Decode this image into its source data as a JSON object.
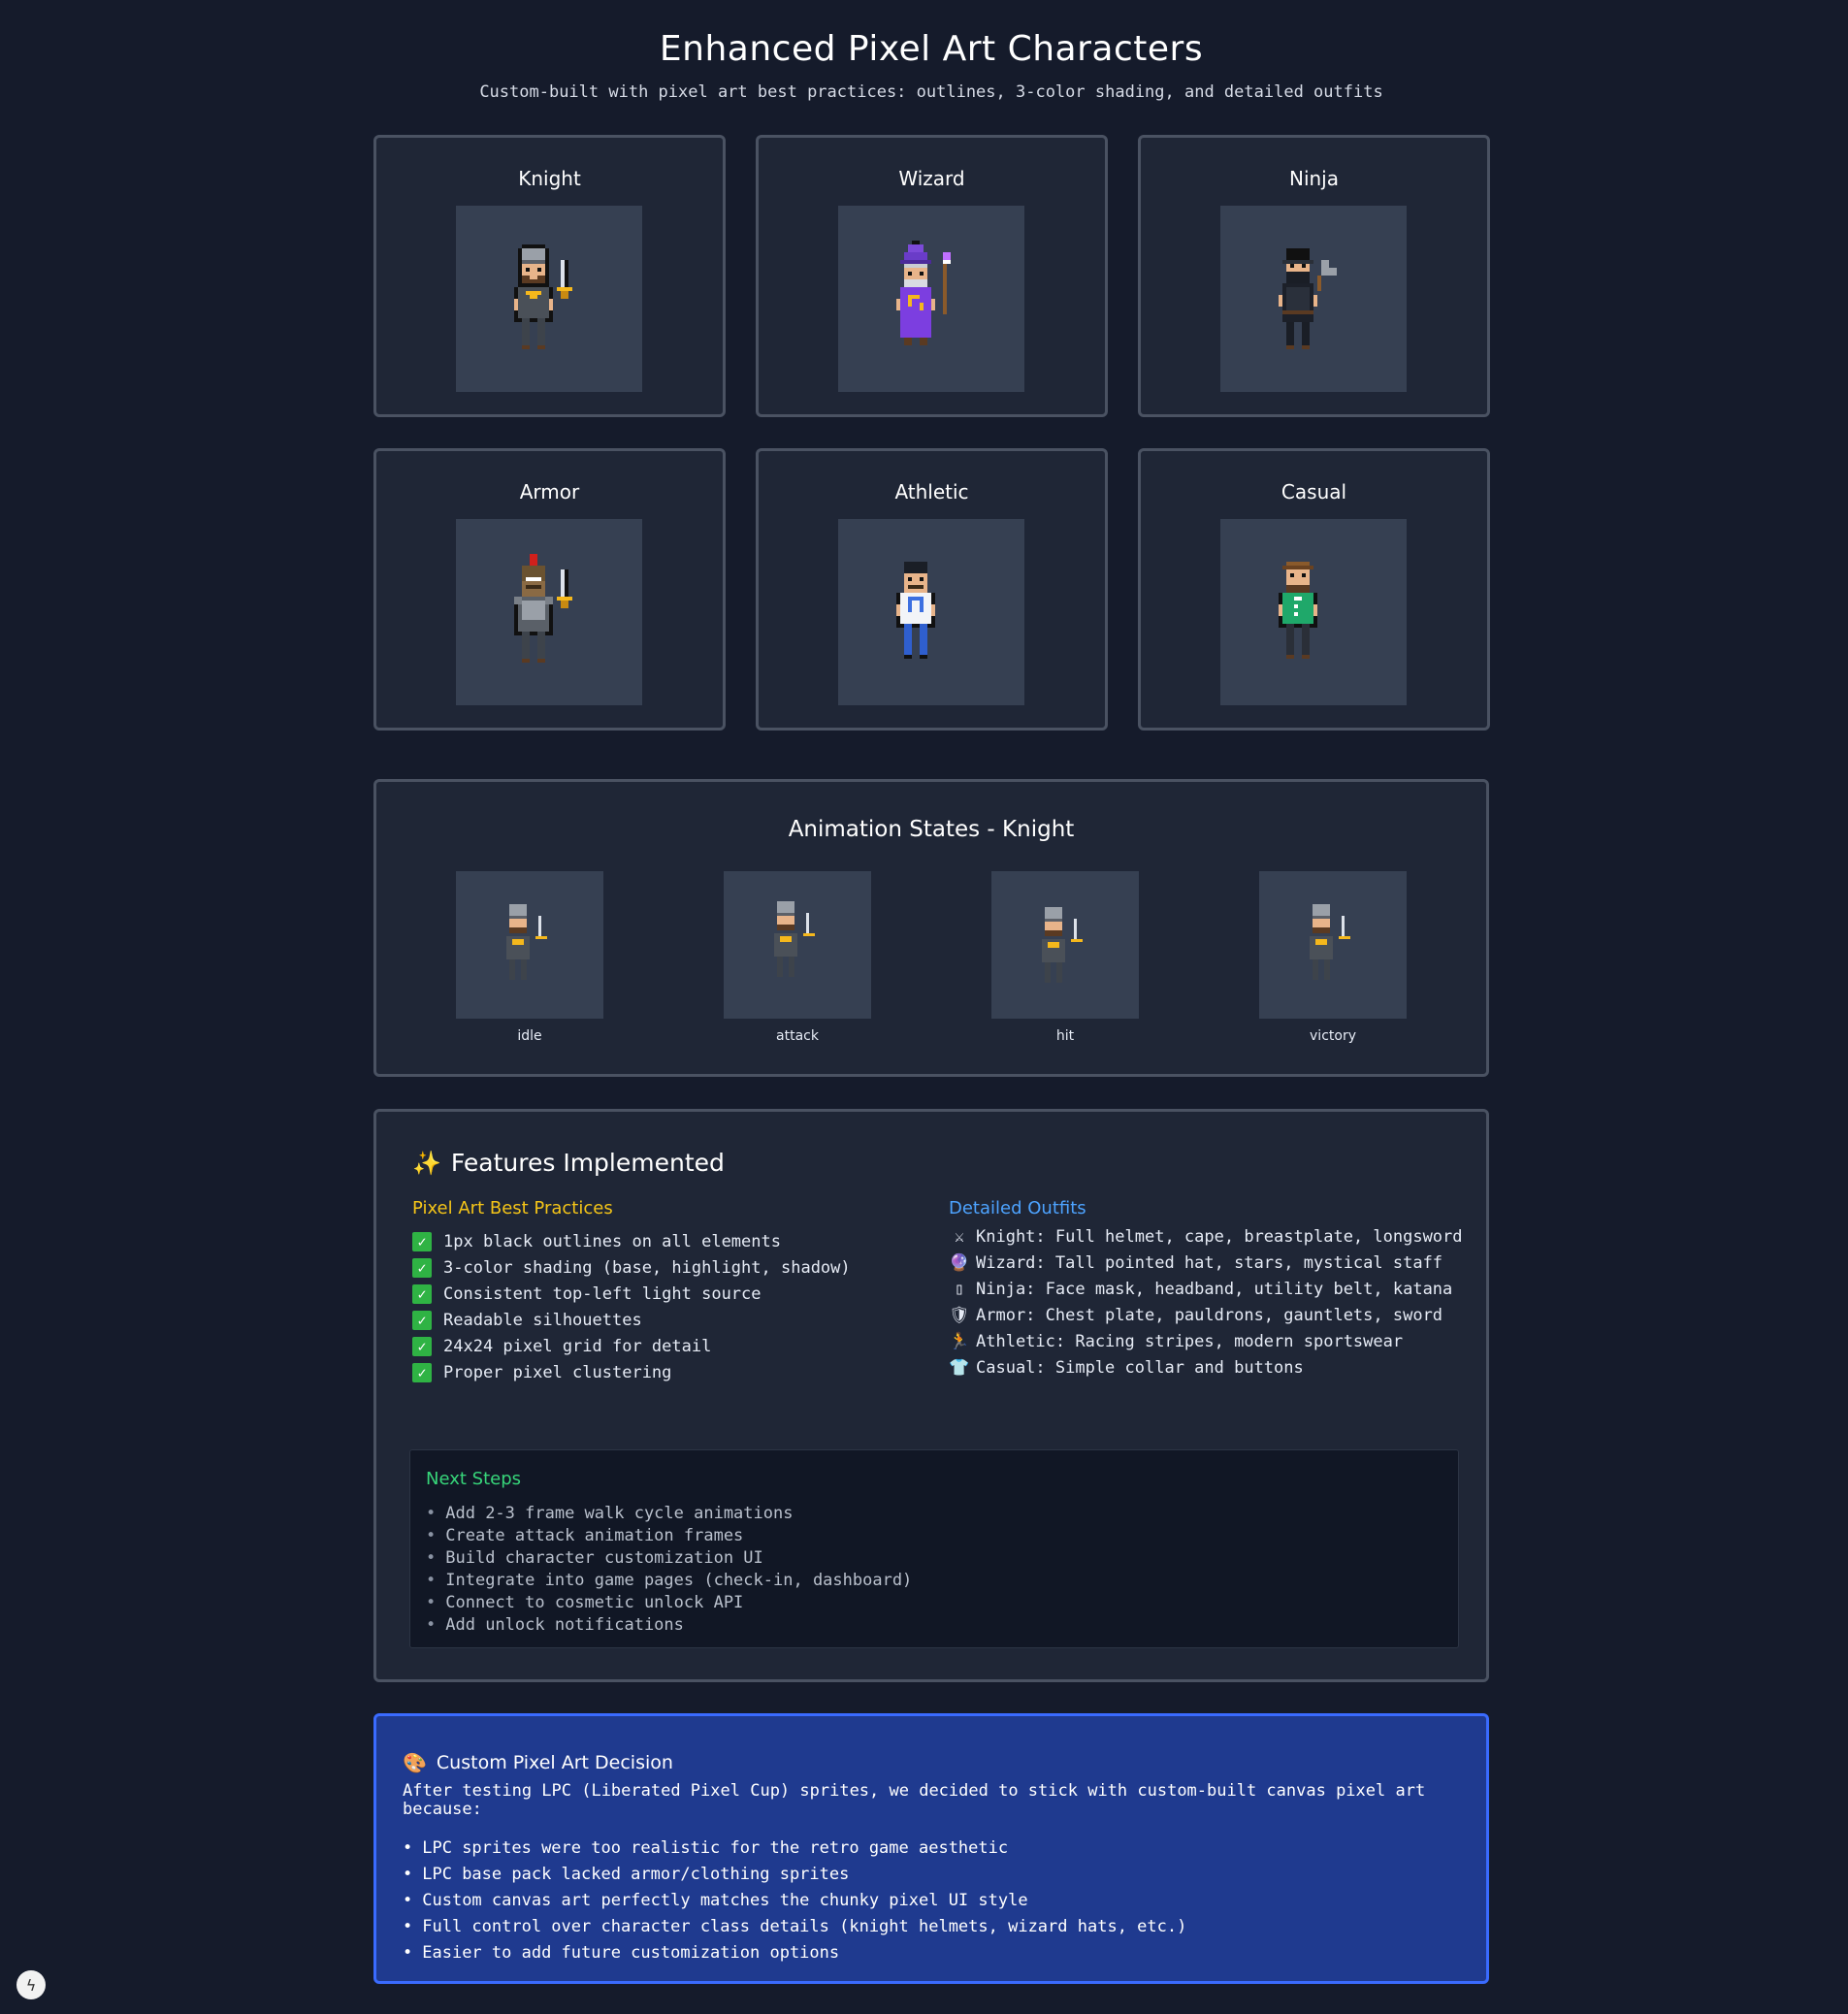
{
  "header": {
    "title": "Enhanced Pixel Art Characters",
    "subtitle": "Custom-built with pixel art best practices: outlines, 3-color shading, and detailed outfits"
  },
  "characters": [
    {
      "label": "Knight",
      "icon": "knight-sprite"
    },
    {
      "label": "Wizard",
      "icon": "wizard-sprite"
    },
    {
      "label": "Ninja",
      "icon": "ninja-sprite"
    },
    {
      "label": "Armor",
      "icon": "armor-sprite"
    },
    {
      "label": "Athletic",
      "icon": "athletic-sprite"
    },
    {
      "label": "Casual",
      "icon": "casual-sprite"
    }
  ],
  "animation": {
    "title": "Animation States - Knight",
    "states": [
      "idle",
      "attack",
      "hit",
      "victory"
    ]
  },
  "features": {
    "title": "Features Implemented",
    "title_icon": "sparkles-icon",
    "best_practices_heading": "Pixel Art Best Practices",
    "best_practices_color": "#f5c518",
    "best_practices": [
      "1px black outlines on all elements",
      "3-color shading (base, highlight, shadow)",
      "Consistent top-left light source",
      "Readable silhouettes",
      "24x24 pixel grid for detail",
      "Proper pixel clustering"
    ],
    "outfits_heading": "Detailed Outfits",
    "outfits_color": "#4da3ff",
    "outfits": [
      {
        "icon": "⚔",
        "text": "Knight: Full helmet, cape, breastplate, longsword"
      },
      {
        "icon": "🔮",
        "text": "Wizard: Tall pointed hat, stars, mystical staff"
      },
      {
        "icon": "▯",
        "text": "Ninja: Face mask, headband, utility belt, katana"
      },
      {
        "icon": "🛡",
        "text": "Armor: Chest plate, pauldrons, gauntlets, sword"
      },
      {
        "icon": "🏃",
        "text": "Athletic: Racing stripes, modern sportswear"
      },
      {
        "icon": "👕",
        "text": "Casual: Simple collar and buttons"
      }
    ],
    "next_steps_title": "Next Steps",
    "next_steps": [
      "Add 2-3 frame walk cycle animations",
      "Create attack animation frames",
      "Build character customization UI",
      "Integrate into game pages (check-in, dashboard)",
      "Connect to cosmetic unlock API",
      "Add unlock notifications"
    ]
  },
  "decision": {
    "title": "Custom Pixel Art Decision",
    "title_icon": "palette-icon",
    "intro": "After testing LPC (Liberated Pixel Cup) sprites, we decided to stick with custom-built canvas pixel art because:",
    "reasons": [
      "LPC sprites were too realistic for the retro game aesthetic",
      "LPC base pack lacked armor/clothing sprites",
      "Custom canvas art perfectly matches the chunky pixel UI style",
      "Full control over character class details (knight helmets, wizard hats, etc.)",
      "Easier to add future customization options"
    ]
  },
  "colors": {
    "background": "#151b2b",
    "card": "#1f2636",
    "card_border": "#4a5262",
    "sprite_bg": "#364052",
    "decision_bg": "#1f3a8f",
    "decision_border": "#3a6bff",
    "next_steps_heading": "#37d67a"
  }
}
